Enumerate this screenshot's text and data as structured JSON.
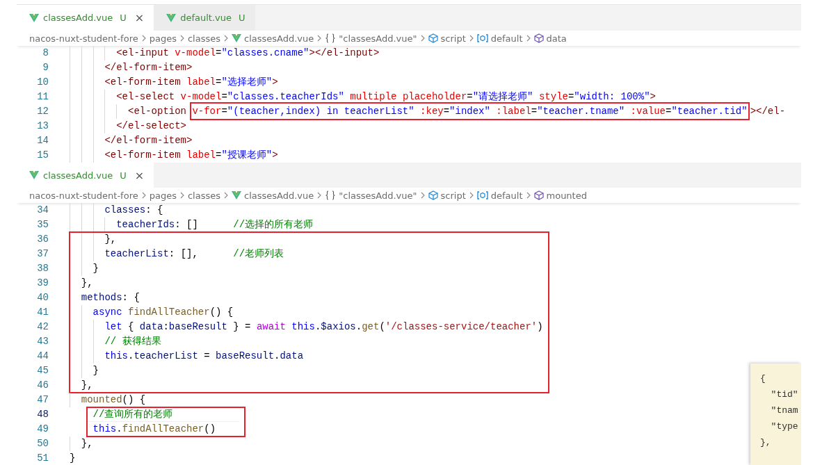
{
  "panels": [
    {
      "tabs": [
        {
          "label": "classesAdd.vue",
          "badge": "U",
          "selected": true,
          "close": "×"
        },
        {
          "label": "default.vue",
          "badge": "U",
          "selected": false
        }
      ],
      "breadcrumb": [
        {
          "label": "nacos-nuxt-student-fore",
          "kind": "plain"
        },
        {
          "label": "pages",
          "kind": "plain"
        },
        {
          "label": "classes",
          "kind": "plain"
        },
        {
          "label": "classesAdd.vue",
          "kind": "vue"
        },
        {
          "label": "\"classesAdd.vue\"",
          "kind": "braces"
        },
        {
          "label": "script",
          "kind": "module"
        },
        {
          "label": "default",
          "kind": "field"
        },
        {
          "label": "data",
          "kind": "method"
        }
      ],
      "code": [
        {
          "kind": "line",
          "n": "8",
          "current": false,
          "text": "        <el-input v-model=\"classes.cname\"></el-input>"
        },
        {
          "kind": "line",
          "n": "9",
          "current": false,
          "text": "      </el-form-item>"
        },
        {
          "kind": "line",
          "n": "10",
          "current": false,
          "text": "      <el-form-item label=\"选择老师\">"
        },
        {
          "kind": "line",
          "n": "11",
          "current": false,
          "text": "        <el-select v-model=\"classes.teacherIds\" multiple placeholder=\"请选择老师\" style=\"width: 100%\">"
        },
        {
          "kind": "line",
          "n": "12",
          "current": false,
          "text": "          <el-option ",
          "boxed": "v-for=\"(teacher,index) in teacherList\" :key=\"index\" :label=\"teacher.tname\" :value=\"teacher.tid\"",
          "after": "></el-"
        },
        {
          "kind": "line",
          "n": "13",
          "current": false,
          "text": "        </el-select>"
        },
        {
          "kind": "line",
          "n": "14",
          "current": false,
          "text": "      </el-form-item>"
        },
        {
          "kind": "line",
          "n": "15",
          "current": false,
          "text": "      <el-form-item label=\"授课老师\">"
        }
      ]
    },
    {
      "tabs": [
        {
          "label": "classesAdd.vue",
          "badge": "U",
          "selected": true,
          "close": "×"
        }
      ],
      "breadcrumb": [
        {
          "label": "nacos-nuxt-student-fore",
          "kind": "plain"
        },
        {
          "label": "pages",
          "kind": "plain"
        },
        {
          "label": "classes",
          "kind": "plain"
        },
        {
          "label": "classesAdd.vue",
          "kind": "vue"
        },
        {
          "label": "\"classesAdd.vue\"",
          "kind": "braces"
        },
        {
          "label": "script",
          "kind": "module"
        },
        {
          "label": "default",
          "kind": "field"
        },
        {
          "label": "mounted",
          "kind": "method"
        }
      ],
      "code": [
        {
          "kind": "line",
          "n": "34",
          "current": false,
          "text": "      classes: {"
        },
        {
          "kind": "line",
          "n": "35",
          "current": false,
          "text": "        teacherIds: []      //选择的所有老师"
        },
        {
          "kind": "box",
          "lines": [
            {
              "kind": "line",
              "n": "36",
              "current": false,
              "text": "      },"
            },
            {
              "kind": "line",
              "n": "37",
              "current": false,
              "text": "      teacherList: [],      //老师列表"
            },
            {
              "kind": "line",
              "n": "38",
              "current": false,
              "text": "    }"
            },
            {
              "kind": "line",
              "n": "39",
              "current": false,
              "text": "  },"
            },
            {
              "kind": "line",
              "n": "40",
              "current": false,
              "text": "  methods: {"
            },
            {
              "kind": "line",
              "n": "41",
              "current": false,
              "text": "    async findAllTeacher() {"
            },
            {
              "kind": "line",
              "n": "42",
              "current": false,
              "text": "      let { data:baseResult } = await this.$axios.get('/classes-service/teacher')"
            },
            {
              "kind": "line",
              "n": "43",
              "current": false,
              "text": "      // 获得结果"
            },
            {
              "kind": "line",
              "n": "44",
              "current": false,
              "text": "      this.teacherList = baseResult.data"
            },
            {
              "kind": "line",
              "n": "45",
              "current": false,
              "text": "    }"
            },
            {
              "kind": "line",
              "n": "46",
              "current": false,
              "text": "  },"
            }
          ]
        },
        {
          "kind": "line",
          "n": "47",
          "current": false,
          "text": "  mounted() {"
        },
        {
          "kind": "box",
          "lines": [
            {
              "kind": "line",
              "n": "48",
              "current": true,
              "text": "    //查询所有的老师"
            },
            {
              "kind": "line",
              "n": "49",
              "current": false,
              "text": "    this.findAllTeacher()"
            }
          ]
        },
        {
          "kind": "line",
          "n": "50",
          "current": false,
          "text": "  },"
        },
        {
          "kind": "line",
          "n": "51",
          "current": false,
          "text": "}"
        }
      ],
      "hover": [
        "{",
        "  \"tid\"",
        "  \"tnam",
        "  \"type",
        "},"
      ]
    }
  ]
}
